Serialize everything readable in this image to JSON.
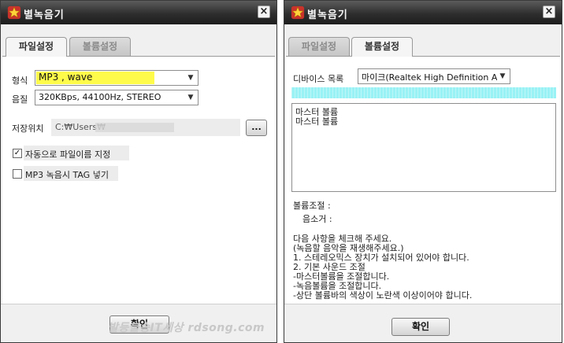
{
  "left_window": {
    "title": "별녹음기",
    "close_glyph": "×",
    "tabs": [
      {
        "label": "파일설정",
        "active": true
      },
      {
        "label": "볼륨설정",
        "active": false
      }
    ],
    "format_label": "형식",
    "format_value": "MP3   , wave",
    "format_highlight_color": "#fffb4a",
    "quality_label": "음질",
    "quality_value": "320KBps, 44100Hz, STEREO",
    "save_location_label": "저장위치",
    "save_location_value": "C:₩Users₩",
    "browse_label": "...",
    "auto_filename_label": "자동으로 파일이름 지정",
    "auto_filename_checked": true,
    "mp3_tag_label": "MP3 녹음시 TAG 넣기",
    "mp3_tag_checked": false,
    "ok_label": "확인"
  },
  "right_window": {
    "title": "별녹음기",
    "close_glyph": "×",
    "tabs": [
      {
        "label": "파일설정",
        "active": false
      },
      {
        "label": "볼륨설정",
        "active": true
      }
    ],
    "device_label": "디바이스 목록",
    "device_value": "마이크(Realtek High Definition Aud",
    "level_meter_color": "#99f2f5",
    "volume_list": [
      "마스터 볼륨",
      "마스터 볼륨"
    ],
    "volume_control_label": "볼륨조절 :",
    "mute_label": "음소거 :",
    "instructions": [
      "다음 사항을 체크해 주세요.",
      "(녹음할 음악을 재생해주세요.)",
      "1. 스테레오믹스 장치가 설치되어 있어야 합니다.",
      "2. 기본 사운드 조절",
      "-마스터볼륨을 조절합니다.",
      "-녹음볼륨을 조절합니다.",
      "-상단 볼륨바의 색상이 노란색 이상이어야 합니다."
    ],
    "ok_label": "확인"
  },
  "watermark": "발등불송IT세상 rdsong.com",
  "icons": {
    "title_icon": "star-icon",
    "dropdown_icon": "chevron-down-icon",
    "close_icon": "close-icon"
  }
}
